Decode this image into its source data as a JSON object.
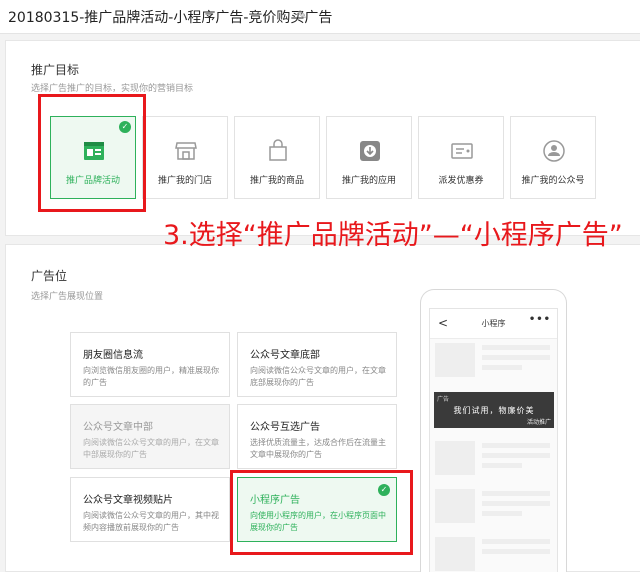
{
  "header": {
    "title": "20180315-推广品牌活动-小程序广告-竞价购买广告"
  },
  "goal": {
    "title": "推广目标",
    "subtitle": "选择广告推广的目标，实现你的营销目标",
    "tiles": [
      {
        "label": "推广品牌活动",
        "icon": "brand-activity-icon",
        "selected": true
      },
      {
        "label": "推广我的门店",
        "icon": "store-icon",
        "selected": false
      },
      {
        "label": "推广我的商品",
        "icon": "shopping-bag-icon",
        "selected": false
      },
      {
        "label": "推广我的应用",
        "icon": "app-download-icon",
        "selected": false
      },
      {
        "label": "派发优惠券",
        "icon": "coupon-icon",
        "selected": false
      },
      {
        "label": "推广我的公众号",
        "icon": "official-account-icon",
        "selected": false
      }
    ]
  },
  "annotation": {
    "text": "3.选择“推广品牌活动”—“小程序广告”"
  },
  "placement": {
    "title": "广告位",
    "subtitle": "选择广告展现位置",
    "cards": [
      {
        "title": "朋友圈信息流",
        "desc": "向浏览微信朋友圈的用户，精准展现你的广告",
        "state": "normal"
      },
      {
        "title": "公众号文章底部",
        "desc": "向阅读微信公众号文章的用户，在文章底部展现你的广告",
        "state": "normal"
      },
      {
        "title": "公众号文章中部",
        "desc": "向阅读微信公众号文章的用户，在文章中部展现你的广告",
        "state": "disabled"
      },
      {
        "title": "公众号互选广告",
        "desc": "选择优质流量主，达成合作后在流量主文章中展现你的广告",
        "state": "normal"
      },
      {
        "title": "公众号文章视频贴片",
        "desc": "向阅读微信公众号文章的用户，其中视频内容播放前展现你的广告",
        "state": "normal"
      },
      {
        "title": "小程序广告",
        "desc": "向使用小程序的用户，在小程序页面中展现你的广告",
        "state": "selected"
      }
    ]
  },
  "preview": {
    "screen_title": "小程序",
    "back_glyph": "<",
    "more_glyph": "•••",
    "ad_tag": "广告",
    "ad_text": "我们试用，物廉价美",
    "ad_button": "活动推广"
  },
  "colors": {
    "accent": "#2eb15b",
    "annotation": "#e8181c"
  }
}
